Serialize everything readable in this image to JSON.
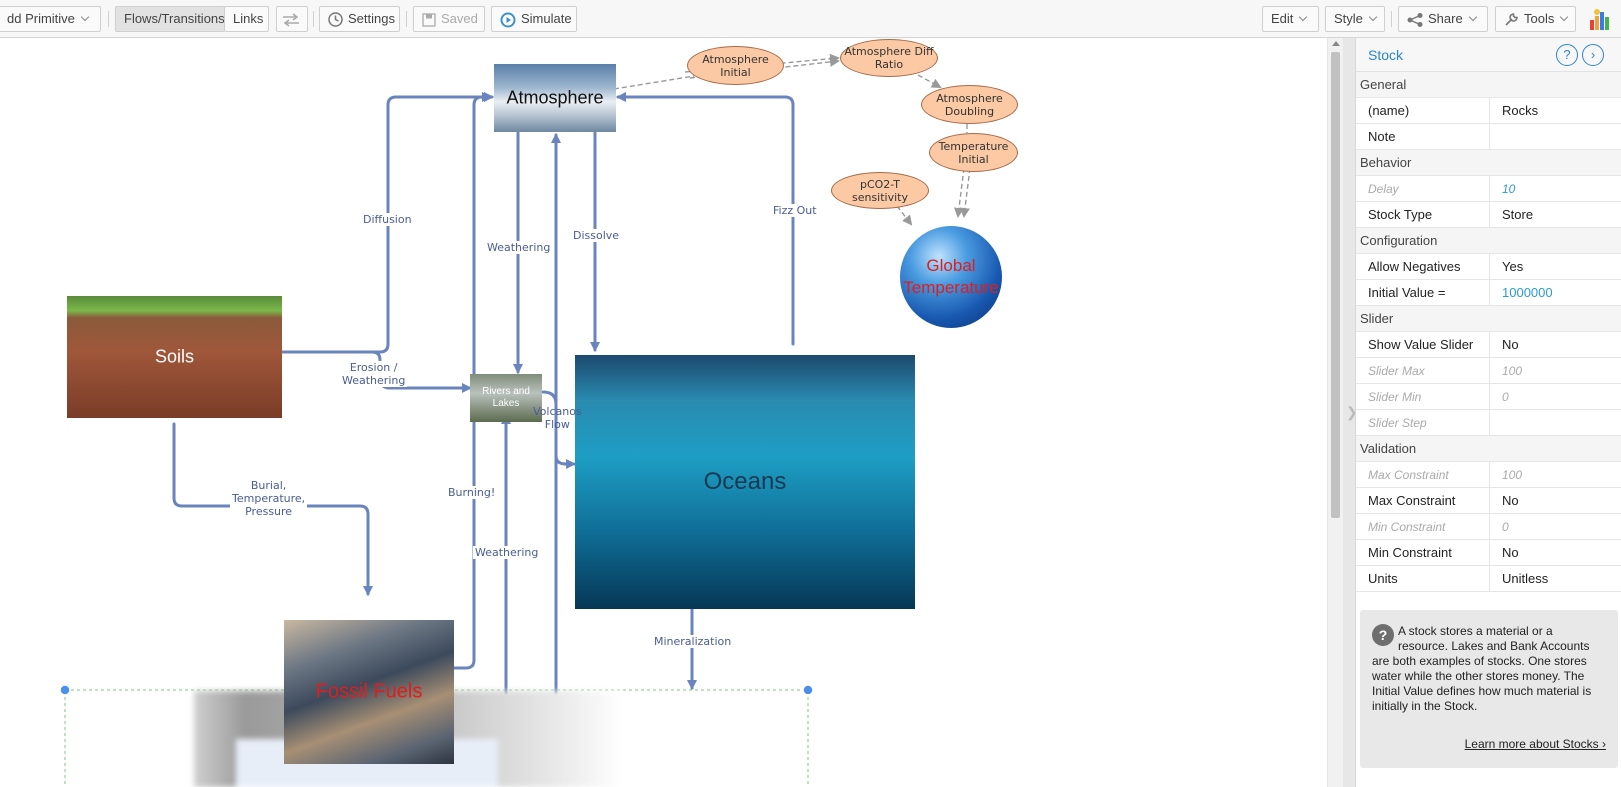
{
  "toolbar": {
    "add_primitive": "dd Primitive",
    "flows_transitions": "Flows/Transitions",
    "links": "Links",
    "settings": "Settings",
    "saved": "Saved",
    "simulate": "Simulate",
    "edit": "Edit",
    "style": "Style",
    "share": "Share",
    "tools": "Tools"
  },
  "diagram": {
    "stocks": {
      "atmosphere": "Atmosphere",
      "soils": "Soils",
      "rivers": "Rivers and\nLakes",
      "oceans": "Oceans",
      "fossil": "Fossil Fuels",
      "global_temp": "Global\nTemperature"
    },
    "flows": {
      "diffusion": "Diffusion",
      "weathering_top": "Weathering",
      "dissolve": "Dissolve",
      "fizz_out": "Fizz Out",
      "erosion": "Erosion /\nWeathering",
      "volcanos": "Volcanos\nFlow",
      "burial": "Burial,\nTemperature,\nPressure",
      "burning": "Burning!",
      "weathering_bottom": "Weathering",
      "mineralization": "Mineralization"
    },
    "variables": {
      "atm_initial": "Atmosphere\nInitial",
      "atm_diff_ratio": "Atmosphere Diff\nRatio",
      "atm_doubling": "Atmosphere\nDoubling",
      "temp_initial": "Temperature\nInitial",
      "pco2": "pCO2-T\nsensitivity"
    }
  },
  "panel": {
    "title": "Stock",
    "sections": [
      {
        "label": "General",
        "rows": [
          {
            "name": "(name)",
            "value": "Rocks"
          },
          {
            "name": "Note",
            "value": ""
          }
        ]
      },
      {
        "label": "Behavior",
        "rows": [
          {
            "name": "Delay",
            "value": "10",
            "disabled": true,
            "link": true
          },
          {
            "name": "Stock Type",
            "value": "Store"
          }
        ]
      },
      {
        "label": "Configuration",
        "rows": [
          {
            "name": "Allow Negatives",
            "value": "Yes"
          },
          {
            "name": "Initial Value =",
            "value": "1000000",
            "link": true
          }
        ]
      },
      {
        "label": "Slider",
        "rows": [
          {
            "name": "Show Value Slider",
            "value": "No"
          },
          {
            "name": "Slider Max",
            "value": "100",
            "disabled": true
          },
          {
            "name": "Slider Min",
            "value": "0",
            "disabled": true
          },
          {
            "name": "Slider Step",
            "value": "",
            "disabled": true
          }
        ]
      },
      {
        "label": "Validation",
        "rows": [
          {
            "name": "Max Constraint",
            "value": "100",
            "disabled": true
          },
          {
            "name": "Max Constraint",
            "value": "No"
          },
          {
            "name": "Min Constraint",
            "value": "0",
            "disabled": true
          },
          {
            "name": "Min Constraint",
            "value": "No"
          },
          {
            "name": "Units",
            "value": "Unitless"
          }
        ]
      }
    ],
    "help_text": "A stock stores a material or a resource. Lakes and Bank Accounts are both examples of stocks. One stores water while the other stores money. The Initial Value defines how much material is initially in the Stock.",
    "learn_more": "Learn more about Stocks ›"
  }
}
